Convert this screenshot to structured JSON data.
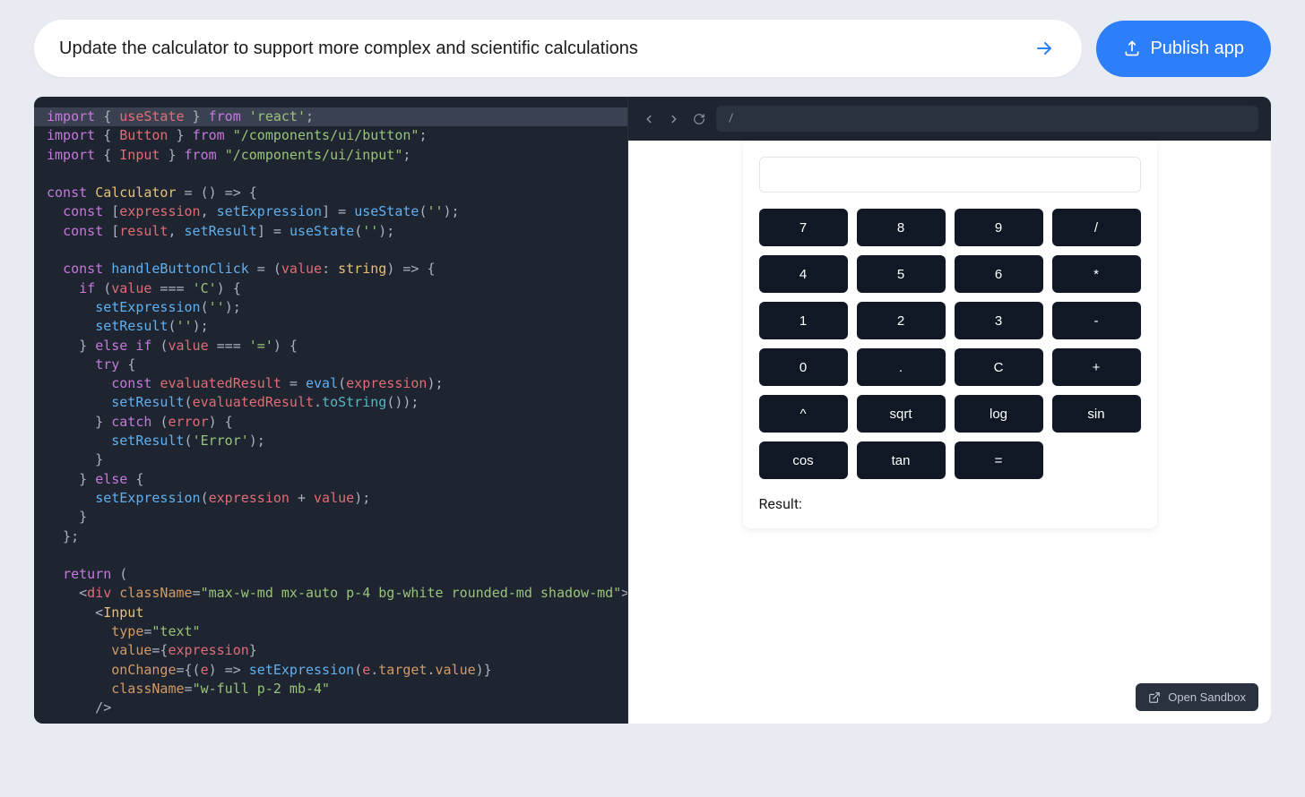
{
  "prompt": {
    "value": "Update the calculator to support more complex and scientific calculations"
  },
  "publish": {
    "label": "Publish app"
  },
  "preview": {
    "url_path": "/",
    "open_sandbox": "Open Sandbox"
  },
  "calculator": {
    "result_label": "Result:",
    "buttons": [
      "7",
      "8",
      "9",
      "/",
      "4",
      "5",
      "6",
      "*",
      "1",
      "2",
      "3",
      "-",
      "0",
      ".",
      "C",
      "+",
      "^",
      "sqrt",
      "log",
      "sin",
      "cos",
      "tan",
      "="
    ]
  },
  "code_lines": [
    {
      "hl": true,
      "segments": [
        {
          "t": "import ",
          "c": "tok-import"
        },
        {
          "t": "{ ",
          "c": "tok-punct"
        },
        {
          "t": "useState",
          "c": "tok-ident"
        },
        {
          "t": " } ",
          "c": "tok-punct"
        },
        {
          "t": "from ",
          "c": "tok-import"
        },
        {
          "t": "'react'",
          "c": "tok-string"
        },
        {
          "t": ";",
          "c": "tok-punct"
        }
      ]
    },
    {
      "segments": [
        {
          "t": "import ",
          "c": "tok-import"
        },
        {
          "t": "{ ",
          "c": "tok-punct"
        },
        {
          "t": "Button",
          "c": "tok-ident"
        },
        {
          "t": " } ",
          "c": "tok-punct"
        },
        {
          "t": "from ",
          "c": "tok-import"
        },
        {
          "t": "\"/components/ui/button\"",
          "c": "tok-string"
        },
        {
          "t": ";",
          "c": "tok-punct"
        }
      ]
    },
    {
      "segments": [
        {
          "t": "import ",
          "c": "tok-import"
        },
        {
          "t": "{ ",
          "c": "tok-punct"
        },
        {
          "t": "Input",
          "c": "tok-ident"
        },
        {
          "t": " } ",
          "c": "tok-punct"
        },
        {
          "t": "from ",
          "c": "tok-import"
        },
        {
          "t": "\"/components/ui/input\"",
          "c": "tok-string"
        },
        {
          "t": ";",
          "c": "tok-punct"
        }
      ]
    },
    {
      "segments": [
        {
          "t": " ",
          "c": "tok-plain"
        }
      ]
    },
    {
      "segments": [
        {
          "t": "const ",
          "c": "tok-const"
        },
        {
          "t": "Calculator",
          "c": "tok-type"
        },
        {
          "t": " = () ",
          "c": "tok-plain"
        },
        {
          "t": "=>",
          "c": "tok-punct"
        },
        {
          "t": " {",
          "c": "tok-punct"
        }
      ]
    },
    {
      "segments": [
        {
          "t": "  ",
          "c": "tok-plain"
        },
        {
          "t": "const ",
          "c": "tok-const"
        },
        {
          "t": "[",
          "c": "tok-punct"
        },
        {
          "t": "expression",
          "c": "tok-ident"
        },
        {
          "t": ", ",
          "c": "tok-punct"
        },
        {
          "t": "setExpression",
          "c": "tok-func"
        },
        {
          "t": "] = ",
          "c": "tok-punct"
        },
        {
          "t": "useState",
          "c": "tok-func"
        },
        {
          "t": "(",
          "c": "tok-punct"
        },
        {
          "t": "''",
          "c": "tok-string"
        },
        {
          "t": ");",
          "c": "tok-punct"
        }
      ]
    },
    {
      "segments": [
        {
          "t": "  ",
          "c": "tok-plain"
        },
        {
          "t": "const ",
          "c": "tok-const"
        },
        {
          "t": "[",
          "c": "tok-punct"
        },
        {
          "t": "result",
          "c": "tok-ident"
        },
        {
          "t": ", ",
          "c": "tok-punct"
        },
        {
          "t": "setResult",
          "c": "tok-func"
        },
        {
          "t": "] = ",
          "c": "tok-punct"
        },
        {
          "t": "useState",
          "c": "tok-func"
        },
        {
          "t": "(",
          "c": "tok-punct"
        },
        {
          "t": "''",
          "c": "tok-string"
        },
        {
          "t": ");",
          "c": "tok-punct"
        }
      ]
    },
    {
      "segments": [
        {
          "t": " ",
          "c": "tok-plain"
        }
      ]
    },
    {
      "segments": [
        {
          "t": "  ",
          "c": "tok-plain"
        },
        {
          "t": "const ",
          "c": "tok-const"
        },
        {
          "t": "handleButtonClick",
          "c": "tok-func"
        },
        {
          "t": " = (",
          "c": "tok-punct"
        },
        {
          "t": "value",
          "c": "tok-ident"
        },
        {
          "t": ": ",
          "c": "tok-punct"
        },
        {
          "t": "string",
          "c": "tok-type"
        },
        {
          "t": ") ",
          "c": "tok-punct"
        },
        {
          "t": "=>",
          "c": "tok-punct"
        },
        {
          "t": " {",
          "c": "tok-punct"
        }
      ]
    },
    {
      "segments": [
        {
          "t": "    ",
          "c": "tok-plain"
        },
        {
          "t": "if ",
          "c": "tok-keyword"
        },
        {
          "t": "(",
          "c": "tok-punct"
        },
        {
          "t": "value",
          "c": "tok-ident"
        },
        {
          "t": " === ",
          "c": "tok-punct"
        },
        {
          "t": "'C'",
          "c": "tok-string"
        },
        {
          "t": ") {",
          "c": "tok-punct"
        }
      ]
    },
    {
      "segments": [
        {
          "t": "      ",
          "c": "tok-plain"
        },
        {
          "t": "setExpression",
          "c": "tok-func"
        },
        {
          "t": "(",
          "c": "tok-punct"
        },
        {
          "t": "''",
          "c": "tok-string"
        },
        {
          "t": ");",
          "c": "tok-punct"
        }
      ]
    },
    {
      "segments": [
        {
          "t": "      ",
          "c": "tok-plain"
        },
        {
          "t": "setResult",
          "c": "tok-func"
        },
        {
          "t": "(",
          "c": "tok-punct"
        },
        {
          "t": "''",
          "c": "tok-string"
        },
        {
          "t": ");",
          "c": "tok-punct"
        }
      ]
    },
    {
      "segments": [
        {
          "t": "    } ",
          "c": "tok-punct"
        },
        {
          "t": "else if ",
          "c": "tok-keyword"
        },
        {
          "t": "(",
          "c": "tok-punct"
        },
        {
          "t": "value",
          "c": "tok-ident"
        },
        {
          "t": " === ",
          "c": "tok-punct"
        },
        {
          "t": "'='",
          "c": "tok-string"
        },
        {
          "t": ") {",
          "c": "tok-punct"
        }
      ]
    },
    {
      "segments": [
        {
          "t": "      ",
          "c": "tok-plain"
        },
        {
          "t": "try ",
          "c": "tok-keyword"
        },
        {
          "t": "{",
          "c": "tok-punct"
        }
      ]
    },
    {
      "segments": [
        {
          "t": "        ",
          "c": "tok-plain"
        },
        {
          "t": "const ",
          "c": "tok-const"
        },
        {
          "t": "evaluatedResult",
          "c": "tok-ident"
        },
        {
          "t": " = ",
          "c": "tok-punct"
        },
        {
          "t": "eval",
          "c": "tok-func"
        },
        {
          "t": "(",
          "c": "tok-punct"
        },
        {
          "t": "expression",
          "c": "tok-ident"
        },
        {
          "t": ");",
          "c": "tok-punct"
        }
      ]
    },
    {
      "segments": [
        {
          "t": "        ",
          "c": "tok-plain"
        },
        {
          "t": "setResult",
          "c": "tok-func"
        },
        {
          "t": "(",
          "c": "tok-punct"
        },
        {
          "t": "evaluatedResult",
          "c": "tok-ident"
        },
        {
          "t": ".",
          "c": "tok-punct"
        },
        {
          "t": "toString",
          "c": "tok-method"
        },
        {
          "t": "());",
          "c": "tok-punct"
        }
      ]
    },
    {
      "segments": [
        {
          "t": "      } ",
          "c": "tok-punct"
        },
        {
          "t": "catch ",
          "c": "tok-keyword"
        },
        {
          "t": "(",
          "c": "tok-punct"
        },
        {
          "t": "error",
          "c": "tok-ident"
        },
        {
          "t": ") {",
          "c": "tok-punct"
        }
      ]
    },
    {
      "segments": [
        {
          "t": "        ",
          "c": "tok-plain"
        },
        {
          "t": "setResult",
          "c": "tok-func"
        },
        {
          "t": "(",
          "c": "tok-punct"
        },
        {
          "t": "'Error'",
          "c": "tok-string"
        },
        {
          "t": ");",
          "c": "tok-punct"
        }
      ]
    },
    {
      "segments": [
        {
          "t": "      }",
          "c": "tok-punct"
        }
      ]
    },
    {
      "segments": [
        {
          "t": "    } ",
          "c": "tok-punct"
        },
        {
          "t": "else ",
          "c": "tok-keyword"
        },
        {
          "t": "{",
          "c": "tok-punct"
        }
      ]
    },
    {
      "segments": [
        {
          "t": "      ",
          "c": "tok-plain"
        },
        {
          "t": "setExpression",
          "c": "tok-func"
        },
        {
          "t": "(",
          "c": "tok-punct"
        },
        {
          "t": "expression",
          "c": "tok-ident"
        },
        {
          "t": " + ",
          "c": "tok-punct"
        },
        {
          "t": "value",
          "c": "tok-ident"
        },
        {
          "t": ");",
          "c": "tok-punct"
        }
      ]
    },
    {
      "segments": [
        {
          "t": "    }",
          "c": "tok-punct"
        }
      ]
    },
    {
      "segments": [
        {
          "t": "  };",
          "c": "tok-punct"
        }
      ]
    },
    {
      "segments": [
        {
          "t": " ",
          "c": "tok-plain"
        }
      ]
    },
    {
      "segments": [
        {
          "t": "  ",
          "c": "tok-plain"
        },
        {
          "t": "return ",
          "c": "tok-keyword"
        },
        {
          "t": "(",
          "c": "tok-punct"
        }
      ]
    },
    {
      "segments": [
        {
          "t": "    <",
          "c": "tok-punct"
        },
        {
          "t": "div ",
          "c": "tok-ident"
        },
        {
          "t": "className",
          "c": "tok-attr"
        },
        {
          "t": "=",
          "c": "tok-punct"
        },
        {
          "t": "\"max-w-md mx-auto p-4 bg-white rounded-md shadow-md\"",
          "c": "tok-string"
        },
        {
          "t": ">",
          "c": "tok-punct"
        }
      ]
    },
    {
      "segments": [
        {
          "t": "      <",
          "c": "tok-punct"
        },
        {
          "t": "Input",
          "c": "tok-type"
        }
      ]
    },
    {
      "segments": [
        {
          "t": "        ",
          "c": "tok-plain"
        },
        {
          "t": "type",
          "c": "tok-attr"
        },
        {
          "t": "=",
          "c": "tok-punct"
        },
        {
          "t": "\"text\"",
          "c": "tok-string"
        }
      ]
    },
    {
      "segments": [
        {
          "t": "        ",
          "c": "tok-plain"
        },
        {
          "t": "value",
          "c": "tok-attr"
        },
        {
          "t": "={",
          "c": "tok-punct"
        },
        {
          "t": "expression",
          "c": "tok-ident"
        },
        {
          "t": "}",
          "c": "tok-punct"
        }
      ]
    },
    {
      "segments": [
        {
          "t": "        ",
          "c": "tok-plain"
        },
        {
          "t": "onChange",
          "c": "tok-attr"
        },
        {
          "t": "={(",
          "c": "tok-punct"
        },
        {
          "t": "e",
          "c": "tok-ident"
        },
        {
          "t": ") ",
          "c": "tok-punct"
        },
        {
          "t": "=>",
          "c": "tok-punct"
        },
        {
          "t": " ",
          "c": "tok-plain"
        },
        {
          "t": "setExpression",
          "c": "tok-func"
        },
        {
          "t": "(",
          "c": "tok-punct"
        },
        {
          "t": "e",
          "c": "tok-ident"
        },
        {
          "t": ".",
          "c": "tok-punct"
        },
        {
          "t": "target",
          "c": "tok-prop"
        },
        {
          "t": ".",
          "c": "tok-punct"
        },
        {
          "t": "value",
          "c": "tok-prop"
        },
        {
          "t": ")}",
          "c": "tok-punct"
        }
      ]
    },
    {
      "segments": [
        {
          "t": "        ",
          "c": "tok-plain"
        },
        {
          "t": "className",
          "c": "tok-attr"
        },
        {
          "t": "=",
          "c": "tok-punct"
        },
        {
          "t": "\"w-full p-2 mb-4\"",
          "c": "tok-string"
        }
      ]
    },
    {
      "segments": [
        {
          "t": "      />",
          "c": "tok-punct"
        }
      ]
    }
  ]
}
